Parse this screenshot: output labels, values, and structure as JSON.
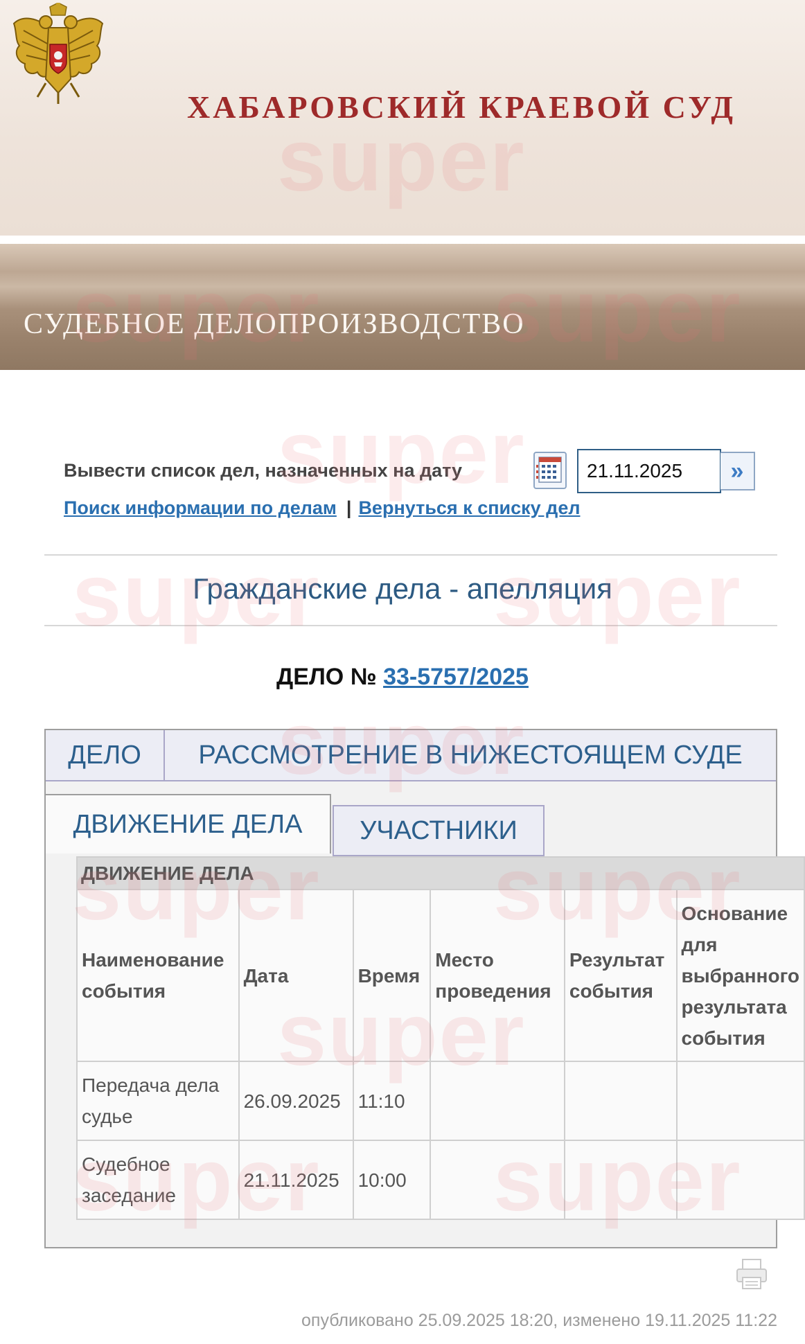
{
  "header": {
    "court_name": "ХАБАРОВСКИЙ КРАЕВОЙ СУД",
    "section_title": "СУДЕБНОЕ ДЕЛОПРОИЗВОДСТВО"
  },
  "watermark": "super",
  "date_filter": {
    "label": "Вывести список дел, назначенных на дату",
    "date_value": "21.11.2025"
  },
  "links": {
    "search": "Поиск информации по делам",
    "separator": "|",
    "back": "Вернуться к списку дел"
  },
  "category": "Гражданские дела - апелляция",
  "case": {
    "prefix": "ДЕЛО №",
    "number": "33-5757/2025"
  },
  "tabs": {
    "row1": [
      "ДЕЛО",
      "РАССМОТРЕНИЕ В НИЖЕСТОЯЩЕМ СУДЕ"
    ],
    "row2": [
      "ДВИЖЕНИЕ ДЕЛА",
      "УЧАСТНИКИ"
    ],
    "active": "ДВИЖЕНИЕ ДЕЛА"
  },
  "events_table": {
    "caption": "ДВИЖЕНИЕ ДЕЛА",
    "columns": [
      "Наименование события",
      "Дата",
      "Время",
      "Место проведения",
      "Результат события",
      "Основание для выбранного результата события"
    ],
    "rows": [
      [
        "Передача дела судье",
        "26.09.2025",
        "11:10",
        "",
        "",
        ""
      ],
      [
        "Судебное заседание",
        "21.11.2025",
        "10:00",
        "",
        "",
        ""
      ]
    ]
  },
  "footer": {
    "published": "опубликовано 25.09.2025 18:20, изменено 19.11.2025 11:22"
  },
  "colors": {
    "court_name": "#9e2a2a",
    "link": "#2a6fb0",
    "category": "#2c5a82",
    "tab_text": "#2c5f8c"
  }
}
